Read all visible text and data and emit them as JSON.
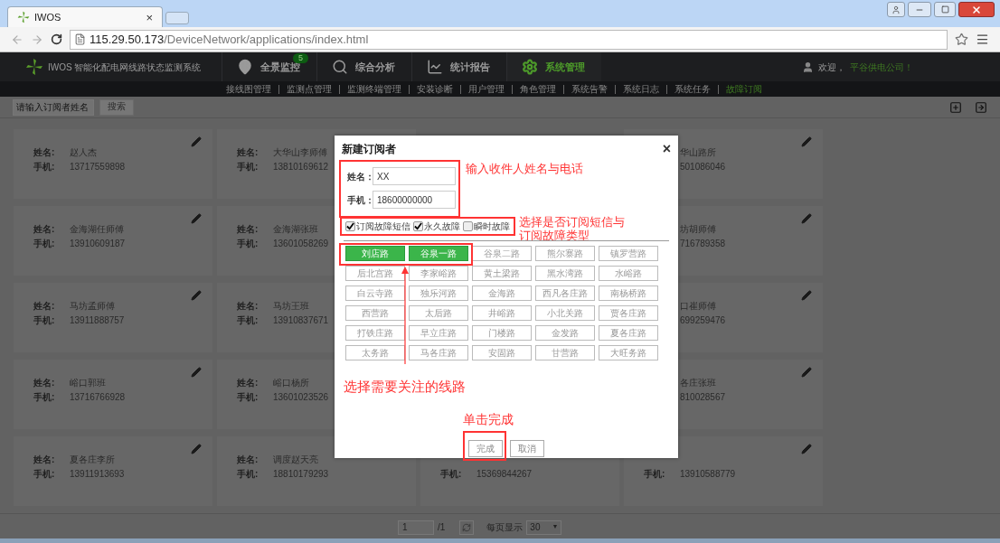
{
  "browser": {
    "tab_title": "IWOS",
    "tab_close": "×",
    "url_host": "115.29.50.173",
    "url_path": "/DeviceNetwork/applications/index.html"
  },
  "nav": {
    "app_title": "IWOS 智能化配电网线路状态监测系统",
    "menus": [
      {
        "label": "全景监控",
        "badge": "5",
        "selected": false
      },
      {
        "label": "综合分析",
        "selected": false
      },
      {
        "label": "统计报告",
        "selected": false
      },
      {
        "label": "系统管理",
        "selected": true
      }
    ],
    "welcome": "欢迎，",
    "company": "平谷供电公司！"
  },
  "subnav": [
    {
      "label": "接线图管理",
      "selected": false
    },
    {
      "label": "监测点管理",
      "selected": false
    },
    {
      "label": "监测终端管理",
      "selected": false
    },
    {
      "label": "安装诊断",
      "selected": false
    },
    {
      "label": "用户管理",
      "selected": false
    },
    {
      "label": "角色管理",
      "selected": false
    },
    {
      "label": "系统告警",
      "selected": false
    },
    {
      "label": "系统日志",
      "selected": false
    },
    {
      "label": "系统任务",
      "selected": false
    },
    {
      "label": "故障订阅",
      "selected": true
    }
  ],
  "toolbar": {
    "search_placeholder": "请输入订阅者姓名",
    "search_button": "搜索"
  },
  "card_rows": [
    [
      {
        "name_label": "姓名:",
        "name": "赵人杰",
        "phone_label": "手机:",
        "phone": "13717559898",
        "edit_icon": true
      },
      {
        "name_label": "姓名:",
        "name": "大华山李师傅",
        "phone_label": "手机:",
        "phone": "13810169612"
      },
      {
        "name": "华山路所",
        "phone": "501086046",
        "edit_icon": true
      }
    ],
    [
      {
        "name_label": "姓名:",
        "name": "金海湖任师傅",
        "phone_label": "手机:",
        "phone": "13910609187",
        "edit_icon": true
      },
      {
        "name_label": "姓名:",
        "name": "金海湖张班",
        "phone_label": "手机:",
        "phone": "13601058269"
      },
      {
        "name": "坊胡师傅",
        "phone": "716789358",
        "edit_icon": true
      }
    ],
    [
      {
        "name_label": "姓名:",
        "name": "马坊孟师傅",
        "phone_label": "手机:",
        "phone": "13911888757",
        "edit_icon": true
      },
      {
        "name_label": "姓名:",
        "name": "马坊王班",
        "phone_label": "手机:",
        "phone": "13910837671"
      },
      {
        "name": "口崔师傅",
        "phone": "699259476",
        "edit_icon": true
      }
    ],
    [
      {
        "name_label": "姓名:",
        "name": "峪口郭班",
        "phone_label": "手机:",
        "phone": "13716766928",
        "edit_icon": true
      },
      {
        "name_label": "姓名:",
        "name": "峪口杨所",
        "phone_label": "手机:",
        "phone": "13601023526"
      },
      {
        "name": "各庄张班",
        "phone": "810028567",
        "edit_icon": true
      }
    ],
    [
      {
        "name_label": "姓名:",
        "name": "夏各庄李所",
        "phone_label": "手机:",
        "phone": "13911913693",
        "edit_icon": true
      },
      {
        "name_label": "姓名:",
        "name": "调度赵天亮",
        "phone_label": "手机:",
        "phone": "18810179293"
      },
      {
        "phone_label": "手机:",
        "phone": "15369844267"
      },
      {
        "phone_label": "手机:",
        "phone": "13910588779",
        "edit_icon": true
      }
    ]
  ],
  "dialog": {
    "title": "新建订阅者",
    "close": "×",
    "fields": [
      {
        "label": "姓名：",
        "value": "XX"
      },
      {
        "label": "手机：",
        "value": "18600000000"
      }
    ],
    "options": [
      {
        "label": "订阅故障短信",
        "checked": true
      },
      {
        "label": "永久故障",
        "checked": true
      },
      {
        "label": "瞬时故障",
        "checked": false
      }
    ],
    "routes": [
      {
        "label": "刘店路",
        "selected": true
      },
      {
        "label": "谷泉一路",
        "selected": true
      },
      {
        "label": "谷泉二路",
        "selected": false
      },
      {
        "label": "熊尔寨路",
        "selected": false
      },
      {
        "label": "镇罗营路",
        "selected": false
      },
      {
        "label": "后北宫路",
        "selected": false
      },
      {
        "label": "李家峪路",
        "selected": false
      },
      {
        "label": "黄土梁路",
        "selected": false
      },
      {
        "label": "黑水湾路",
        "selected": false
      },
      {
        "label": "水峪路",
        "selected": false
      },
      {
        "label": "白云寺路",
        "selected": false
      },
      {
        "label": "独乐河路",
        "selected": false
      },
      {
        "label": "金海路",
        "selected": false
      },
      {
        "label": "西凡各庄路",
        "selected": false
      },
      {
        "label": "南杨桥路",
        "selected": false
      },
      {
        "label": "西营路",
        "selected": false
      },
      {
        "label": "太后路",
        "selected": false
      },
      {
        "label": "井峪路",
        "selected": false
      },
      {
        "label": "小北关路",
        "selected": false
      },
      {
        "label": "贾各庄路",
        "selected": false
      },
      {
        "label": "打铁庄路",
        "selected": false
      },
      {
        "label": "早立庄路",
        "selected": false
      },
      {
        "label": "门楼路",
        "selected": false
      },
      {
        "label": "金发路",
        "selected": false
      },
      {
        "label": "夏各庄路",
        "selected": false
      },
      {
        "label": "太务路",
        "selected": false
      },
      {
        "label": "马各庄路",
        "selected": false
      },
      {
        "label": "安固路",
        "selected": false
      },
      {
        "label": "甘营路",
        "selected": false
      },
      {
        "label": "大旺务路",
        "selected": false
      }
    ],
    "buttons": [
      "完成",
      "取消"
    ],
    "notes": [
      "输入收件人姓名与电话",
      "选择是否订阅短信与订阅故障类型",
      "选择需要关注的线路",
      "单击完成"
    ]
  },
  "pager": {
    "page": "1",
    "total": "/1",
    "per_page_label": "每页显示",
    "per_page": "30",
    "caret": "▼"
  }
}
